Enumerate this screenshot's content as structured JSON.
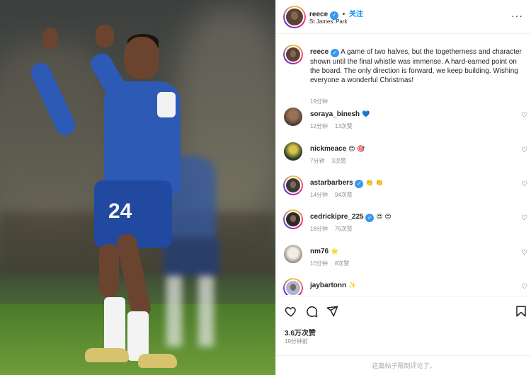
{
  "post": {
    "username": "reece",
    "follow_label": "关注",
    "location": "St James' Park",
    "more_label": "···"
  },
  "caption": {
    "username": "reece",
    "text": "A game of two halves, but the togetherness and character shown until the final whistle was immense. A hard-earned point on the board. The only direction is forward, we keep building. Wishing everyone a wonderful Christmas!",
    "time": "19分钟"
  },
  "photo": {
    "shirt_number": "24"
  },
  "comments": [
    {
      "username": "soraya_binesh",
      "verified": false,
      "text": "💙",
      "time": "12分钟",
      "likes": "13次赞"
    },
    {
      "username": "nickmeace",
      "verified": false,
      "text": "😍 🎯",
      "time": "7分钟",
      "likes": "3次赞"
    },
    {
      "username": "astarbarbers",
      "verified": true,
      "text": "👏 👏",
      "time": "14分钟",
      "likes": "94次赞"
    },
    {
      "username": "cedrickipre_225",
      "verified": true,
      "text": "😍 😍",
      "time": "18分钟",
      "likes": "76次赞"
    },
    {
      "username": "nm76",
      "verified": false,
      "text": "⭐",
      "time": "10分钟",
      "likes": "8次赞"
    },
    {
      "username": "jaybartonn",
      "verified": false,
      "text": "✨",
      "time": "",
      "likes": ""
    }
  ],
  "stats": {
    "likes": "3.6万次赞",
    "time": "19分钟前"
  },
  "limited_comments_notice": "这篇帖子限制评论了。",
  "icons": {
    "like": "heart-icon",
    "comment": "comment-icon",
    "share": "send-icon",
    "save": "bookmark-icon",
    "verified": "verified-badge-icon"
  },
  "colors": {
    "accent": "#0095f6",
    "verified": "#3897f0",
    "secondary_text": "#8e8e8e"
  }
}
